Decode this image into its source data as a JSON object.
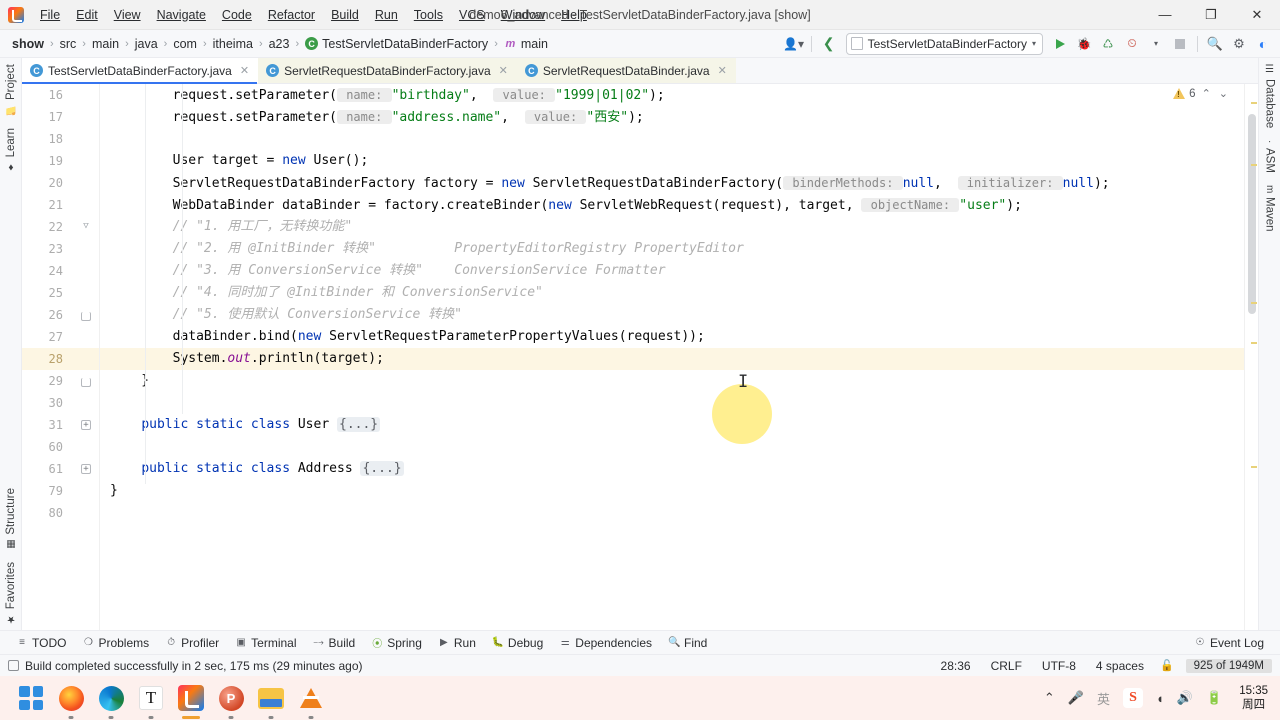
{
  "window": {
    "title": "demo6_advanced - TestServletDataBinderFactory.java [show]",
    "minimize": "—",
    "maximize": "❐",
    "close": "✕"
  },
  "menubar": {
    "items": [
      {
        "label": "File"
      },
      {
        "label": "Edit"
      },
      {
        "label": "View"
      },
      {
        "label": "Navigate"
      },
      {
        "label": "Code"
      },
      {
        "label": "Refactor"
      },
      {
        "label": "Build"
      },
      {
        "label": "Run"
      },
      {
        "label": "Tools"
      },
      {
        "label": "VCS"
      },
      {
        "label": "Window"
      },
      {
        "label": "Help"
      }
    ]
  },
  "navbar": {
    "breadcrumbs": [
      {
        "label": "show"
      },
      {
        "label": "src"
      },
      {
        "label": "main"
      },
      {
        "label": "java"
      },
      {
        "label": "com"
      },
      {
        "label": "itheima"
      },
      {
        "label": "a23"
      },
      {
        "label": "TestServletDataBinderFactory"
      },
      {
        "label": "main"
      }
    ],
    "separator": "›",
    "run_config": "TestServletDataBinderFactory",
    "run_config_arrow": "▾"
  },
  "tabs": [
    {
      "label": "TestServletDataBinderFactory.java",
      "active": true,
      "close": "✕"
    },
    {
      "label": "ServletRequestDataBinderFactory.java",
      "active": false,
      "close": "✕"
    },
    {
      "label": "ServletRequestDataBinder.java",
      "active": false,
      "close": "✕"
    }
  ],
  "left_strip": {
    "top": [
      {
        "label": "Project",
        "icon": "folder-icon"
      },
      {
        "label": "Learn",
        "icon": "compass-icon"
      }
    ],
    "bottom": [
      {
        "label": "Structure",
        "icon": "structure-icon"
      },
      {
        "label": "Favorites",
        "icon": "star-icon"
      }
    ]
  },
  "right_strip": {
    "items": [
      {
        "label": "Database",
        "icon": "database-icon"
      },
      {
        "label": "ASM",
        "icon": "asm-icon"
      },
      {
        "label": "Maven",
        "icon": "maven-icon"
      }
    ]
  },
  "inspection": {
    "warning_count": "6",
    "up": "⌃",
    "down": "⌄"
  },
  "editor": {
    "lines": [
      {
        "num": "16",
        "fold": "",
        "hl": false,
        "tokens": [
          {
            "t": "        request.setParameter(",
            "c": "plain"
          },
          {
            "t": " name: ",
            "c": "hint"
          },
          {
            "t": "\"birthday\"",
            "c": "str"
          },
          {
            "t": ",  ",
            "c": "plain"
          },
          {
            "t": " value: ",
            "c": "hint"
          },
          {
            "t": "\"1999|01|02\"",
            "c": "str"
          },
          {
            "t": ");",
            "c": "plain"
          }
        ]
      },
      {
        "num": "17",
        "fold": "",
        "hl": false,
        "tokens": [
          {
            "t": "        request.setParameter(",
            "c": "plain"
          },
          {
            "t": " name: ",
            "c": "hint"
          },
          {
            "t": "\"address.name\"",
            "c": "str"
          },
          {
            "t": ",  ",
            "c": "plain"
          },
          {
            "t": " value: ",
            "c": "hint"
          },
          {
            "t": "\"西安\"",
            "c": "str"
          },
          {
            "t": ");",
            "c": "plain"
          }
        ]
      },
      {
        "num": "18",
        "fold": "",
        "hl": false,
        "tokens": []
      },
      {
        "num": "19",
        "fold": "",
        "hl": false,
        "tokens": [
          {
            "t": "        User target = ",
            "c": "plain"
          },
          {
            "t": "new",
            "c": "kw"
          },
          {
            "t": " User();",
            "c": "plain"
          }
        ]
      },
      {
        "num": "20",
        "fold": "",
        "hl": false,
        "tokens": [
          {
            "t": "        ServletRequestDataBinderFactory factory = ",
            "c": "plain"
          },
          {
            "t": "new",
            "c": "kw"
          },
          {
            "t": " ServletRequestDataBinderFactory(",
            "c": "plain"
          },
          {
            "t": " binderMethods: ",
            "c": "hint"
          },
          {
            "t": "null",
            "c": "kw"
          },
          {
            "t": ",  ",
            "c": "plain"
          },
          {
            "t": " initializer: ",
            "c": "hint"
          },
          {
            "t": "null",
            "c": "kw"
          },
          {
            "t": ");",
            "c": "plain"
          }
        ]
      },
      {
        "num": "21",
        "fold": "",
        "hl": false,
        "tokens": [
          {
            "t": "        WebDataBinder dataBinder = factory.createBinder(",
            "c": "plain"
          },
          {
            "t": "new",
            "c": "kw"
          },
          {
            "t": " ServletWebRequest(request), target, ",
            "c": "plain"
          },
          {
            "t": " objectName: ",
            "c": "hint"
          },
          {
            "t": "\"user\"",
            "c": "str"
          },
          {
            "t": ");",
            "c": "plain"
          }
        ]
      },
      {
        "num": "22",
        "fold": "chev",
        "hl": false,
        "tokens": [
          {
            "t": "        // \"1. 用工厂，无转换功能\"",
            "c": "cmt"
          }
        ]
      },
      {
        "num": "23",
        "fold": "",
        "hl": false,
        "tokens": [
          {
            "t": "        // \"2. 用 @InitBinder 转换\"          PropertyEditorRegistry PropertyEditor",
            "c": "cmt"
          }
        ]
      },
      {
        "num": "24",
        "fold": "",
        "hl": false,
        "tokens": [
          {
            "t": "        // \"3. 用 ConversionService 转换\"    ConversionService Formatter",
            "c": "cmt"
          }
        ]
      },
      {
        "num": "25",
        "fold": "",
        "hl": false,
        "tokens": [
          {
            "t": "        // \"4. 同时加了 @InitBinder 和 ConversionService\"",
            "c": "cmt"
          }
        ]
      },
      {
        "num": "26",
        "fold": "brk",
        "hl": false,
        "tokens": [
          {
            "t": "        // \"5. 使用默认 ConversionService 转换\"",
            "c": "cmt"
          }
        ]
      },
      {
        "num": "27",
        "fold": "",
        "hl": false,
        "tokens": [
          {
            "t": "        dataBinder.bind(",
            "c": "plain"
          },
          {
            "t": "new",
            "c": "kw"
          },
          {
            "t": " ServletRequestParameterPropertyValues(request));",
            "c": "plain"
          }
        ]
      },
      {
        "num": "28",
        "fold": "",
        "hl": true,
        "tokens": [
          {
            "t": "        System.",
            "c": "plain"
          },
          {
            "t": "out",
            "c": "field"
          },
          {
            "t": ".println(target);",
            "c": "plain"
          }
        ]
      },
      {
        "num": "29",
        "fold": "brk",
        "hl": false,
        "tokens": [
          {
            "t": "    }",
            "c": "plain"
          }
        ]
      },
      {
        "num": "30",
        "fold": "",
        "hl": false,
        "tokens": []
      },
      {
        "num": "31",
        "fold": "plus",
        "hl": false,
        "tokens": [
          {
            "t": "    ",
            "c": "plain"
          },
          {
            "t": "public static class",
            "c": "kw"
          },
          {
            "t": " User ",
            "c": "plain"
          },
          {
            "t": "{...}",
            "c": "foldph"
          }
        ]
      },
      {
        "num": "60",
        "fold": "",
        "hl": false,
        "tokens": []
      },
      {
        "num": "61",
        "fold": "plus",
        "hl": false,
        "tokens": [
          {
            "t": "    ",
            "c": "plain"
          },
          {
            "t": "public static class",
            "c": "kw"
          },
          {
            "t": " Address ",
            "c": "plain"
          },
          {
            "t": "{...}",
            "c": "foldph"
          }
        ]
      },
      {
        "num": "79",
        "fold": "",
        "hl": false,
        "tokens": [
          {
            "t": "}",
            "c": "plain"
          }
        ]
      },
      {
        "num": "80",
        "fold": "",
        "hl": false,
        "tokens": []
      }
    ]
  },
  "bottom_toolwindows": [
    {
      "label": "TODO",
      "icon": "list-icon"
    },
    {
      "label": "Problems",
      "icon": "error-circle-icon"
    },
    {
      "label": "Profiler",
      "icon": "gauge-icon"
    },
    {
      "label": "Terminal",
      "icon": "terminal-icon"
    },
    {
      "label": "Build",
      "icon": "hammer-icon"
    },
    {
      "label": "Spring",
      "icon": "leaf-icon"
    },
    {
      "label": "Run",
      "icon": "play-icon"
    },
    {
      "label": "Debug",
      "icon": "bug-icon"
    },
    {
      "label": "Dependencies",
      "icon": "layers-icon"
    },
    {
      "label": "Find",
      "icon": "search-icon"
    }
  ],
  "event_log": {
    "label": "Event Log",
    "icon": "bell-icon"
  },
  "statusbar": {
    "build_message": "Build completed successfully in 2 sec, 175 ms (29 minutes ago)",
    "caret": "28:36",
    "line_separator": "CRLF",
    "encoding": "UTF-8",
    "indent": "4 spaces",
    "lock_icon": "lock-open-icon",
    "memory": "925 of 1949M"
  },
  "taskbar": {
    "apps": [
      {
        "name": "start-button",
        "icon": "windows-logo-icon"
      },
      {
        "name": "firefox",
        "icon": "firefox-icon"
      },
      {
        "name": "edge",
        "icon": "edge-icon"
      },
      {
        "name": "typora",
        "icon": "typora-icon"
      },
      {
        "name": "intellij-idea",
        "icon": "intellij-idea-icon"
      },
      {
        "name": "powerpoint",
        "icon": "powerpoint-icon"
      },
      {
        "name": "file-explorer",
        "icon": "folder-icon"
      },
      {
        "name": "vlc",
        "icon": "vlc-cone-icon"
      }
    ],
    "tray": {
      "chevron": "⌃",
      "mic": "mic-icon",
      "ime": "英",
      "sogou": "S",
      "wifi": "wifi-icon",
      "volume": "volume-icon",
      "battery": "battery-icon"
    },
    "clock_time": "15:35",
    "clock_day": "周四"
  }
}
